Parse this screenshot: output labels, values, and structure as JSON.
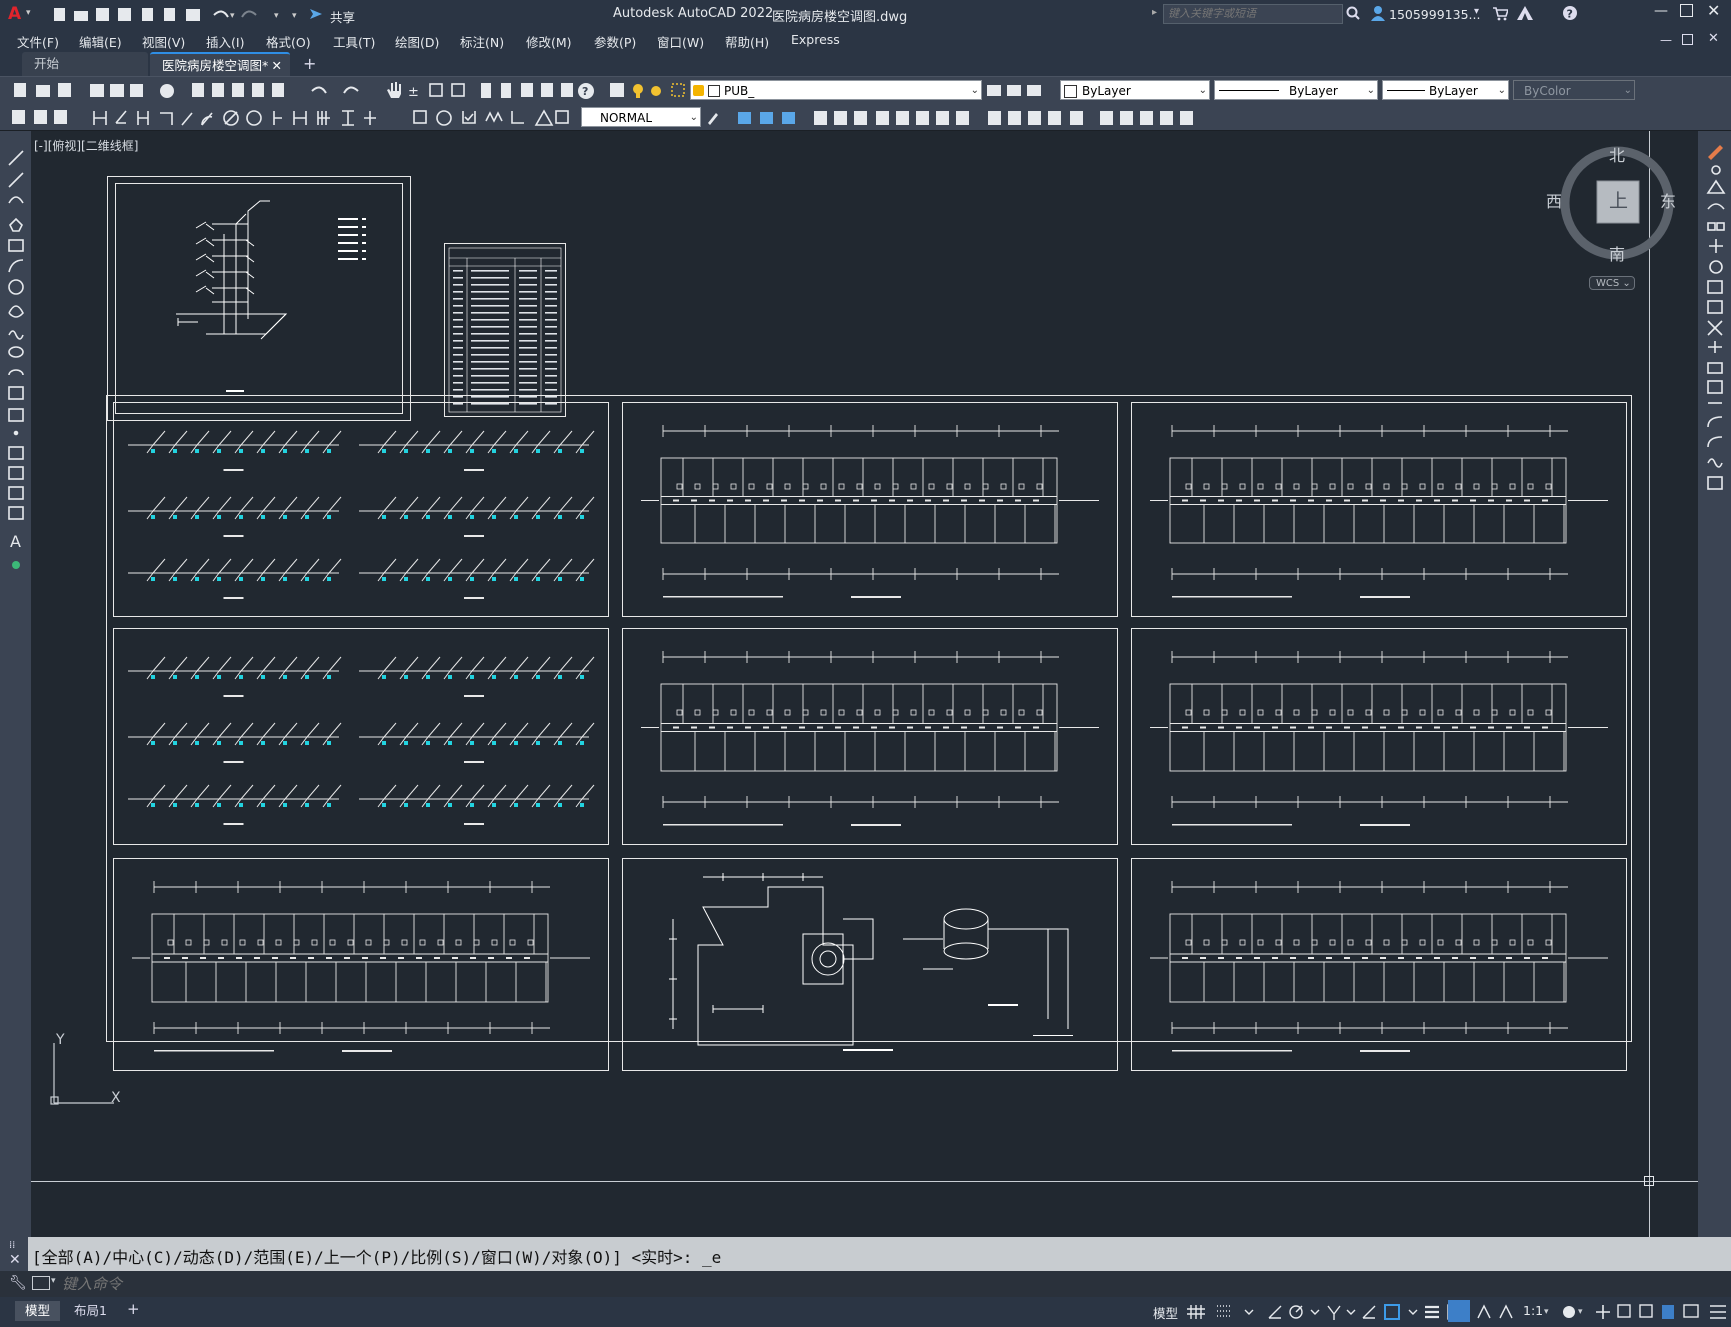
{
  "titlebar": {
    "app_logo": "A",
    "title": "Autodesk AutoCAD 2022",
    "filename": "医院病房楼空调图.dwg",
    "share": "共享",
    "search_placeholder": "键入关键字或短语",
    "user": "1505999135...",
    "icons": [
      "new-icon",
      "open-icon",
      "save-icon",
      "saveas-icon",
      "export-icon",
      "import-icon",
      "print-icon",
      "undo-icon",
      "redo-icon",
      "share-icon",
      "search-icon",
      "user-icon",
      "cart-icon",
      "autodesk-icon",
      "help-icon"
    ]
  },
  "menubar": {
    "items": [
      "文件(F)",
      "编辑(E)",
      "视图(V)",
      "插入(I)",
      "格式(O)",
      "工具(T)",
      "绘图(D)",
      "标注(N)",
      "修改(M)",
      "参数(P)",
      "窗口(W)",
      "帮助(H)",
      "Express"
    ]
  },
  "tabs": {
    "items": [
      {
        "label": "开始",
        "active": false
      },
      {
        "label": "医院病房楼空调图*",
        "active": true
      }
    ]
  },
  "toolbar": {
    "layer": "PUB_",
    "color": "ByLayer",
    "linetype": "ByLayer",
    "lineweight": "ByLayer",
    "plotstyle": "ByColor",
    "textstyle": "NORMAL"
  },
  "viewport": {
    "label": "[-][俯视][二维线框]",
    "viewcube": {
      "north": "北",
      "south": "南",
      "east": "东",
      "west": "西",
      "face": "上",
      "wcs": "WCS"
    },
    "ucs": {
      "x": "X",
      "y": "Y"
    }
  },
  "command": {
    "history": "[全部(A)/中心(C)/动态(D)/范围(E)/上一个(P)/比例(S)/窗口(W)/对象(O)] <实时>: _e",
    "placeholder": "键入命令"
  },
  "statusbar": {
    "tabs": [
      "模型",
      "布局1"
    ],
    "model_label": "模型",
    "scale": "1:1"
  },
  "colors": {
    "bg": "#212830",
    "panel": "#3b4453",
    "accent_cyan": "#22d3e0",
    "line": "#e8e8e8"
  }
}
